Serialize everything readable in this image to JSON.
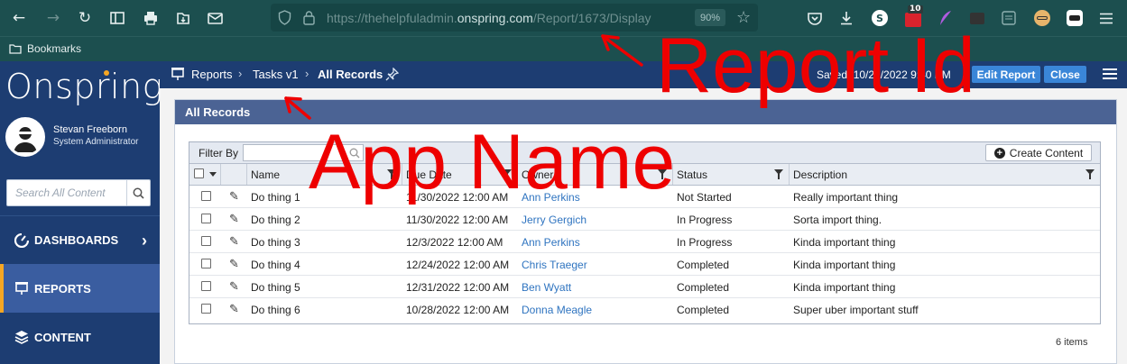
{
  "browser": {
    "url_prefix": "https://thehelpfuladmin.",
    "url_domain": "onspring.com",
    "url_path": "/Report/1673/Display",
    "zoom": "90%",
    "notification_badge": "10",
    "profile_letter": "S",
    "bookmarks_label": "Bookmarks"
  },
  "sidebar": {
    "logo": "Onspring",
    "user_name": "Stevan Freeborn",
    "user_role": "System Administrator",
    "search_placeholder": "Search All Content",
    "nav": [
      {
        "label": "DASHBOARDS"
      },
      {
        "label": "REPORTS"
      },
      {
        "label": "CONTENT"
      }
    ]
  },
  "breadcrumb": {
    "items": [
      "Reports",
      "Tasks v1",
      "All Records"
    ],
    "saved": "Saved: 10/29/2022 9:40 PM",
    "edit_report": "Edit Report",
    "close": "Close"
  },
  "panel": {
    "title": "All Records",
    "filter_label": "Filter By",
    "create_label": "Create Content",
    "columns": [
      "Name",
      "Due Date",
      "Owner",
      "Status",
      "Description"
    ],
    "rows": [
      {
        "name": "Do thing 1",
        "due": "11/30/2022 12:00 AM",
        "owner": "Ann Perkins",
        "status": "Not Started",
        "desc": "Really important thing"
      },
      {
        "name": "Do thing 2",
        "due": "11/30/2022 12:00 AM",
        "owner": "Jerry Gergich",
        "status": "In Progress",
        "desc": "Sorta import thing."
      },
      {
        "name": "Do thing 3",
        "due": "12/3/2022 12:00 AM",
        "owner": "Ann Perkins",
        "status": "In Progress",
        "desc": "Kinda important thing"
      },
      {
        "name": "Do thing 4",
        "due": "12/24/2022 12:00 AM",
        "owner": "Chris Traeger",
        "status": "Completed",
        "desc": "Kinda important thing"
      },
      {
        "name": "Do thing 5",
        "due": "12/31/2022 12:00 AM",
        "owner": "Ben Wyatt",
        "status": "Completed",
        "desc": "Kinda important thing"
      },
      {
        "name": "Do thing 6",
        "due": "10/28/2022 12:00 AM",
        "owner": "Donna Meagle",
        "status": "Completed",
        "desc": "Super uber important stuff"
      }
    ],
    "item_count": "6 items"
  },
  "annotations": {
    "report_id": "Report Id",
    "app_name": "App Name"
  },
  "colors": {
    "browser_bg": "#1c4f4f",
    "sidebar_bg": "#1d3d72",
    "accent": "#f5a623",
    "panel_header": "#4b6394",
    "link": "#2f74c0",
    "button": "#3a86d8",
    "annotation": "#ee0000"
  }
}
